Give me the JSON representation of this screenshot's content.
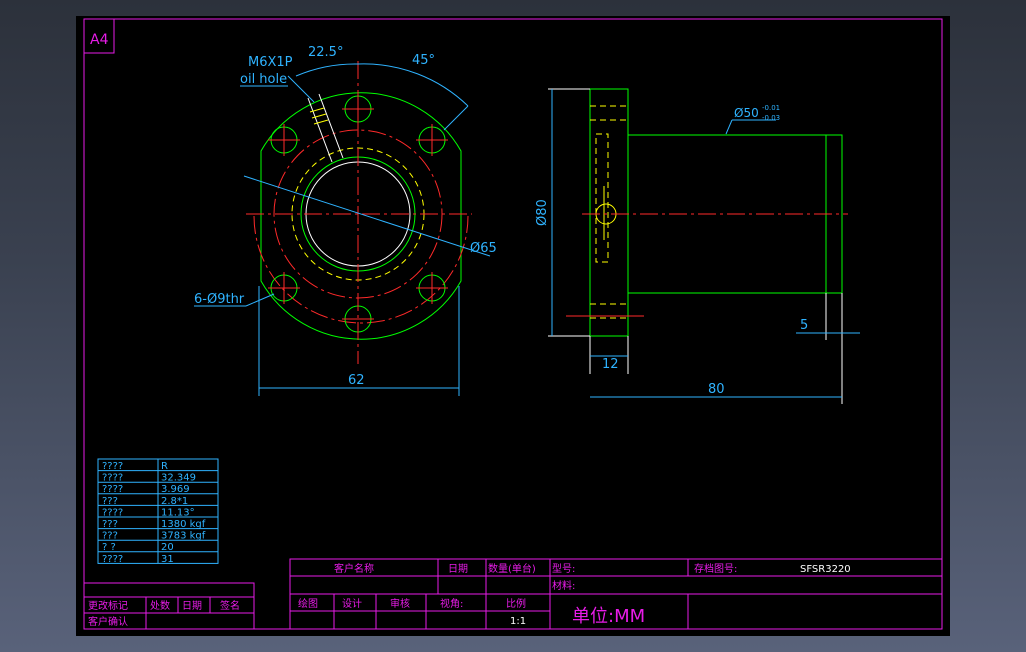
{
  "sheet": {
    "size_label": "A4"
  },
  "front_view": {
    "thread_label": "M6X1P",
    "oil_hole_label": "oil hole",
    "angle_1": "22.5°",
    "angle_2": "45°",
    "pcd_label": "Ø65",
    "holes_label": "6-Ø9thr",
    "width_dim": "62"
  },
  "side_view": {
    "shaft_dia": "Ø50",
    "shaft_tol_upper": "-0.01",
    "shaft_tol_lower": "-0.03",
    "flange_dia": "Ø80",
    "flange_thk": "12",
    "total_len": "80",
    "end_step": "5"
  },
  "params_table": {
    "rows": [
      [
        "????",
        "R"
      ],
      [
        "????",
        "32.349"
      ],
      [
        "????",
        "3.969"
      ],
      [
        " ???",
        "2.8*1"
      ],
      [
        "????",
        "11.13°"
      ],
      [
        " ???",
        "1380 kgf"
      ],
      [
        " ???",
        "3783 kgf"
      ],
      [
        " ?  ?",
        "20"
      ],
      [
        "????",
        "31"
      ]
    ]
  },
  "title_block": {
    "customer_name_label": "客户名称",
    "date_label": "日期",
    "qty_label": "数量(单台)",
    "model_label": "型号:",
    "drawing_no_label": "存档图号:",
    "drawing_no_value": "SFSR3220",
    "material_label": "材料:",
    "draw_label": "绘图",
    "design_label": "设计",
    "review_label": "审核",
    "view_label": "视角:",
    "scale_label": "比例",
    "scale_value": "1:1",
    "unit_text": "单位:MM",
    "change_mark_label": "更改标记",
    "place_count_label": "处数",
    "change_date_label": "日期",
    "sign_label": "签名",
    "customer_confirm_label": "客户确认"
  }
}
